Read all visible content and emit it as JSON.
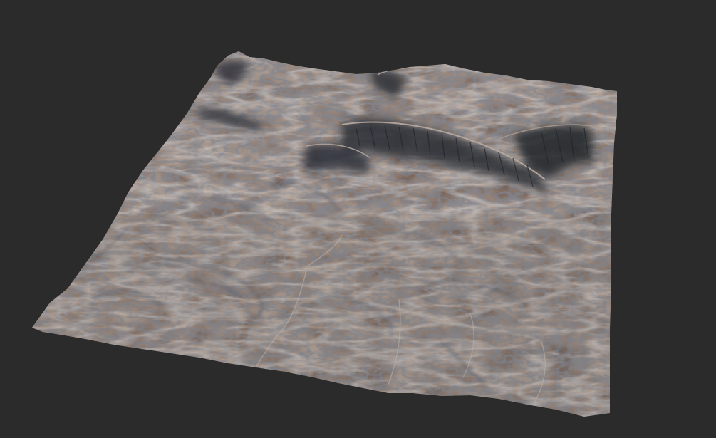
{
  "viewport": {
    "background_color": "#2b2b2b"
  },
  "terrain": {
    "subject": "3d-terrain-heightmap-render",
    "colors": {
      "base": "#7d6a60",
      "light": "#a08a7c",
      "rust": "#8a6a58",
      "shadow": "#3a3d45",
      "deep_shadow": "#23262d",
      "highlight": "#b8aaa0",
      "blue_rock": "#4a5260"
    }
  }
}
